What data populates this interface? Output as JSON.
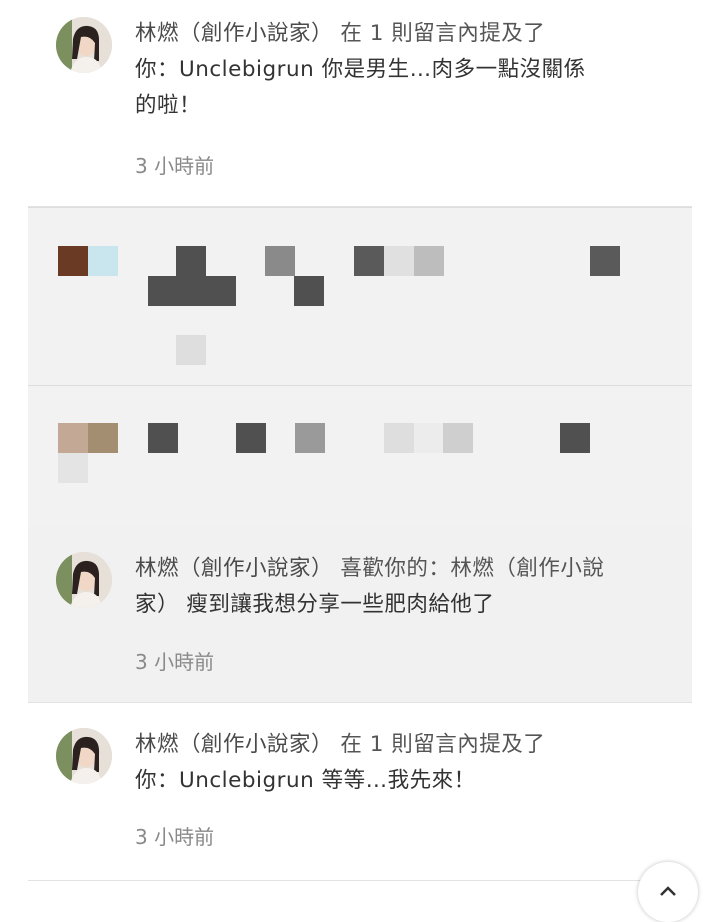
{
  "notifications": [
    {
      "author": "林燃（創作小說家）",
      "action": "在 1 則留言內提及了",
      "line2": "你：Unclebigrun 你是男生…肉多一點沒關係",
      "line3": "的啦！",
      "time": "3 小時前"
    },
    {
      "author": "林燃（創作小說家）",
      "action": "喜歡你的：林燃（創作小說",
      "line2": "家） 瘦到讓我想分享一些肥肉給他了",
      "time": "3 小時前"
    },
    {
      "author": "林燃（創作小說家）",
      "action": "在 1 則留言內提及了",
      "line2": "你：Unclebigrun 等等…我先來！",
      "time": "3 小時前"
    }
  ],
  "icons": {
    "scroll_top": "chevron-up-icon"
  },
  "colors": {
    "highlight_bg": "#f1f1f1",
    "time_text": "#8a8a8a"
  }
}
